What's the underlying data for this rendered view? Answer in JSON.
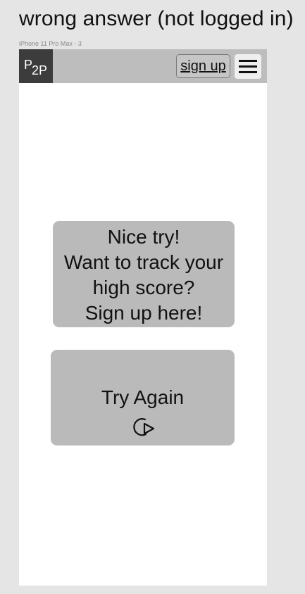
{
  "page": {
    "title": "wrong answer (not logged in)",
    "frame_label": "iPhone 11 Pro Max - 3"
  },
  "header": {
    "logo_main": "P",
    "logo_sub": "2P",
    "signup_label": "sign up",
    "menu_icon": "hamburger-menu-icon"
  },
  "message_card": {
    "lines": [
      "Nice try!",
      "Want to track your",
      "high score?",
      "Sign up here!"
    ]
  },
  "retry_card": {
    "label": "Try Again",
    "icon": "retry-play-icon"
  }
}
